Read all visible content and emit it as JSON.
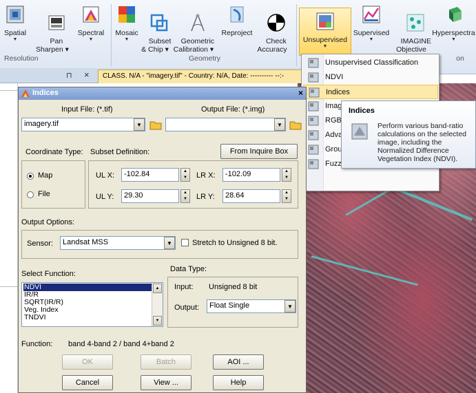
{
  "ribbon": {
    "buttons": [
      {
        "id": "spatial",
        "label": "Spatial"
      },
      {
        "id": "pan_sharpen",
        "label": "Pan\nSharpen ▾"
      },
      {
        "id": "spectral",
        "label": "Spectral"
      },
      {
        "id": "mosaic",
        "label": "Mosaic"
      },
      {
        "id": "subset",
        "label": "Subset\n& Chip ▾"
      },
      {
        "id": "geometric",
        "label": "Geometric\nCalibration ▾"
      },
      {
        "id": "reproject",
        "label": "Reproject"
      },
      {
        "id": "check",
        "label": "Check\nAccuracy"
      },
      {
        "id": "unsupervised",
        "label": "Unsupervised"
      },
      {
        "id": "supervised",
        "label": "Supervised"
      },
      {
        "id": "imagine",
        "label": "IMAGINE\nObjective"
      },
      {
        "id": "hyperspectral",
        "label": "Hyperspectra"
      }
    ],
    "groups": {
      "resolution": "Resolution",
      "geometry": "Geometry",
      "classification_tail": "on"
    }
  },
  "tabstrip": {
    "pin_glyph": "⊓",
    "close_glyph": "×",
    "doc_tab": "CLASS. N/A - \"imagery.tif\" - Country: N/A, Date: ---------- --:-"
  },
  "menu": {
    "items": [
      {
        "label": "Unsupervised Classification"
      },
      {
        "label": "NDVI"
      },
      {
        "label": "Indices"
      },
      {
        "label": "Image"
      },
      {
        "label": "RGB C"
      },
      {
        "label": "Advar"
      },
      {
        "label": "Group"
      },
      {
        "label": "Fuzzy"
      }
    ]
  },
  "tooltip": {
    "title": "Indices",
    "body": "Perform various band-ratio calculations on the selected image, including the Normalized Difference Vegetation Index (NDVI)."
  },
  "dialog": {
    "title": "Indices",
    "close_glyph": "×",
    "input_file_label": "Input File: (*.tif)",
    "output_file_label": "Output File: (*.img)",
    "input_file_value": "imagery.tif",
    "output_file_value": "",
    "coordinate_type_label": "Coordinate Type:",
    "subset_definition_label": "Subset Definition:",
    "from_inquire_box": "From Inquire Box",
    "coord_map": "Map",
    "coord_file": "File",
    "ulx_label": "UL X:",
    "uly_label": "UL Y:",
    "lrx_label": "LR X:",
    "lry_label": "LR Y:",
    "ulx": "-102.84",
    "uly": "29.30",
    "lrx": "-102.09",
    "lry": "28.64",
    "output_options_label": "Output Options:",
    "sensor_label": "Sensor:",
    "sensor_value": "Landsat MSS",
    "stretch_label": "Stretch to Unsigned 8 bit.",
    "select_function_label": "Select Function:",
    "functions": [
      "NDVI",
      "IR/R",
      "SQRT(IR/R)",
      "Veg. Index",
      "TNDVI"
    ],
    "data_type_label": "Data Type:",
    "input_label": "Input:",
    "input_type": "Unsigned 8 bit",
    "output_label": "Output:",
    "output_type": "Float Single",
    "function_label": "Function:",
    "function_expr": "band 4-band 2 / band 4+band 2",
    "buttons": {
      "ok": "OK",
      "batch": "Batch",
      "aoi": "AOI ...",
      "cancel": "Cancel",
      "view": "View ...",
      "help": "Help"
    }
  },
  "colors": {
    "accent_selection": "#1b2b79",
    "menu_highlight": "#fde9a9",
    "river": "#58c7c4"
  }
}
